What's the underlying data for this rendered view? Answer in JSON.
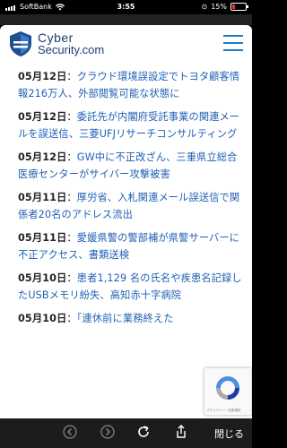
{
  "status_bar": {
    "carrier": "SoftBank",
    "time": "3:55",
    "battery": "15%"
  },
  "header": {
    "logo_line1": "Cyber",
    "logo_line2": "Security.com"
  },
  "news": [
    {
      "date": "05月12日",
      "sep": "：",
      "text": "クラウド環境誤設定でトヨタ顧客情報216万人、外部閲覧可能な状態に"
    },
    {
      "date": "05月12日",
      "sep": "：",
      "text": "委託先が内閣府受託事業の関連メールを誤送信、三菱UFJリサーチコンサルティング"
    },
    {
      "date": "05月12日",
      "sep": "：",
      "text": "GW中に不正改ざん、三重県立総合医療センターがサイバー攻撃被害"
    },
    {
      "date": "05月11日",
      "sep": "：",
      "text": "厚労省、入札関連メール誤送信で関係者20名のアドレス流出"
    },
    {
      "date": "05月11日",
      "sep": "：",
      "text": "愛媛県警の警部補が県警サーバーに不正アクセス、書類送検"
    },
    {
      "date": "05月10日",
      "sep": "：",
      "text": "患者1,129 名の氏名や疾患名記録したUSBメモリ紛失、高知赤十字病院"
    },
    {
      "date": "05月10日",
      "sep": "：",
      "text": "「連休前に業務終えた"
    }
  ],
  "recaptcha": {
    "footer": "プライバシー・利用規約"
  },
  "toolbar": {
    "close_label": "閉じる"
  },
  "colors": {
    "link": "#1f5fb4",
    "logo": "#1f3d6e",
    "menu": "#1f7ac9"
  }
}
